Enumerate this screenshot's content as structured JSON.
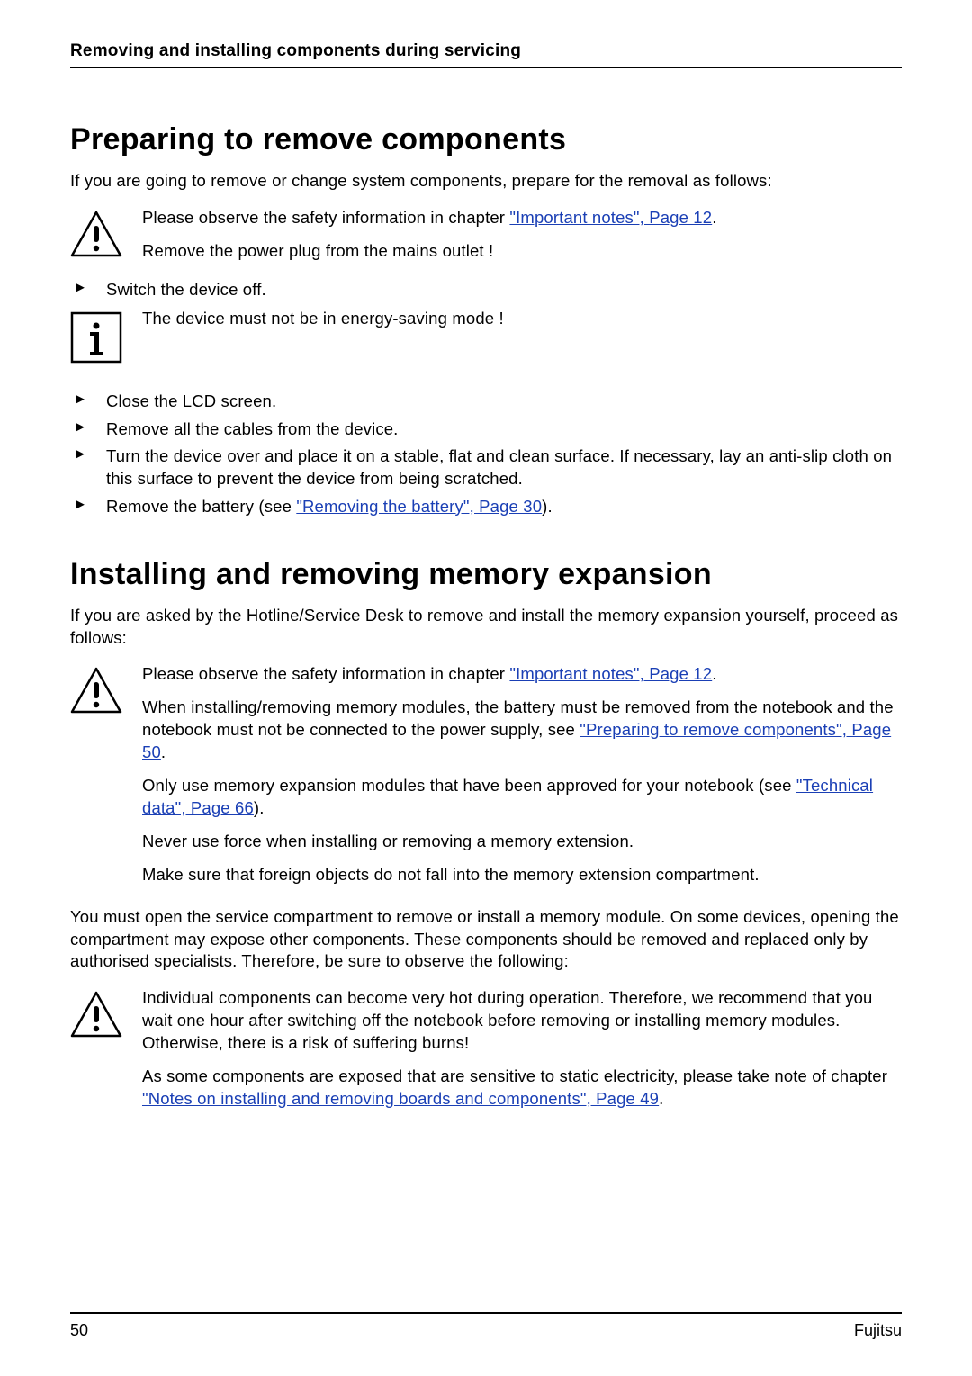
{
  "header": {
    "title": "Removing and installing components during servicing"
  },
  "section1": {
    "heading": "Preparing to remove components",
    "intro": "If you are going to remove or change system components, prepare for the removal as follows:",
    "warn1_pre": "Please observe the safety information in chapter ",
    "warn1_link": "\"Important notes\", Page 12",
    "warn1_post": ".",
    "warn1_line2": "Remove the power plug from the mains outlet !",
    "step1": "Switch the device off.",
    "info_line": "The device must not be in energy-saving mode !",
    "step2": "Close the LCD screen.",
    "step3": "Remove all the cables from the device.",
    "step4": "Turn the device over and place it on a stable, flat and clean surface. If necessary, lay an anti-slip cloth on this surface to prevent the device from being scratched.",
    "step5_pre": "Remove the battery (see ",
    "step5_link": "\"Removing the battery\", Page 30",
    "step5_post": ")."
  },
  "section2": {
    "heading": "Installing and removing memory expansion",
    "intro": "If you are asked by the Hotline/Service Desk to remove and install the memory expansion yourself, proceed as follows:",
    "warn2_p1_pre": "Please observe the safety information in chapter ",
    "warn2_p1_link": "\"Important notes\", Page 12",
    "warn2_p1_post": ".",
    "warn2_p2_pre": "When installing/removing memory modules, the battery must be removed from the notebook and the notebook must not be connected to the power supply, see ",
    "warn2_p2_link": "\"Preparing to remove components\", Page 50",
    "warn2_p2_post": ".",
    "warn2_p3_pre": "Only use memory expansion modules that have been approved for your notebook (see ",
    "warn2_p3_link": "\"Technical data\", Page 66",
    "warn2_p3_post": ").",
    "warn2_p4": "Never use force when installing or removing a memory extension.",
    "warn2_p5": "Make sure that foreign objects do not fall into the memory extension compartment.",
    "body_para": "You must open the service compartment to remove or install a memory module. On some devices, opening the compartment may expose other components. These components should be removed and replaced only by authorised specialists. Therefore, be sure to observe the following:",
    "warn3_p1": "Individual components can become very hot during operation. Therefore, we recommend that you wait one hour after switching off the notebook before removing or installing memory modules. Otherwise, there is a risk of suffering burns!",
    "warn3_p2_pre": "As some components are exposed that are sensitive to static electricity, please take note of chapter ",
    "warn3_p2_link": "\"Notes on installing and removing boards and components\", Page 49",
    "warn3_p2_post": "."
  },
  "footer": {
    "page": "50",
    "brand": "Fujitsu"
  }
}
